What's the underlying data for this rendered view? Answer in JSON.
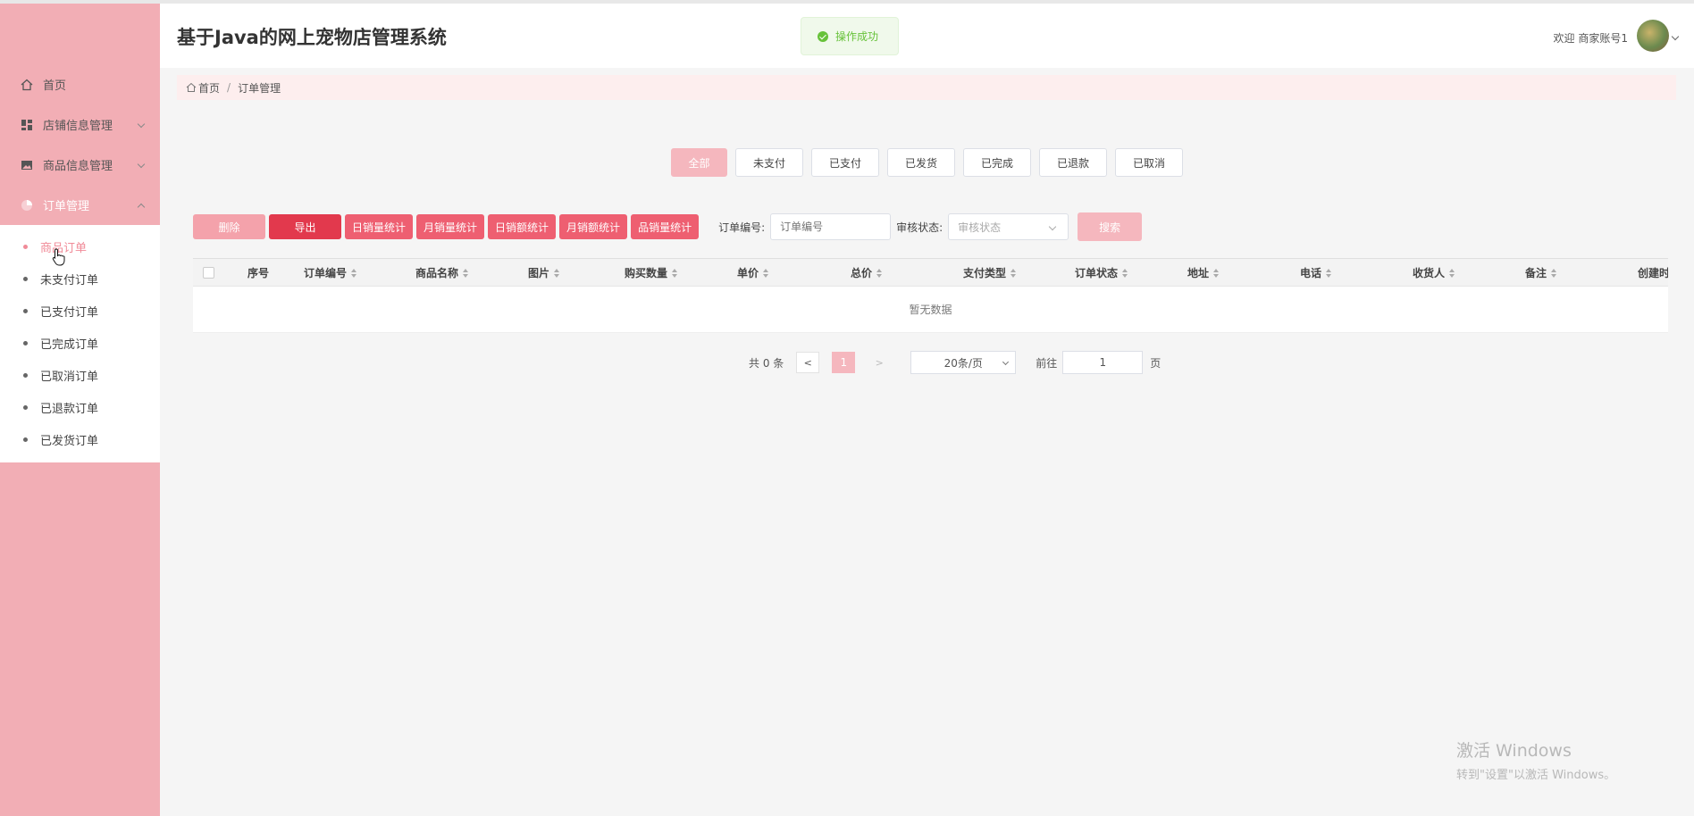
{
  "app": {
    "title": "基于Java的网上宠物店管理系统"
  },
  "toast": {
    "message": "操作成功"
  },
  "user": {
    "welcome": "欢迎 商家账号1"
  },
  "sidebar": {
    "items": [
      {
        "label": "首页"
      },
      {
        "label": "店铺信息管理"
      },
      {
        "label": "商品信息管理"
      },
      {
        "label": "订单管理"
      }
    ],
    "submenu": [
      {
        "label": "商品订单"
      },
      {
        "label": "未支付订单"
      },
      {
        "label": "已支付订单"
      },
      {
        "label": "已完成订单"
      },
      {
        "label": "已取消订单"
      },
      {
        "label": "已退款订单"
      },
      {
        "label": "已发货订单"
      }
    ]
  },
  "breadcrumb": {
    "home": "首页",
    "current": "订单管理"
  },
  "status_filters": [
    "全部",
    "未支付",
    "已支付",
    "已发货",
    "已完成",
    "已退款",
    "已取消"
  ],
  "toolbar": {
    "delete": "删除",
    "export": "导出",
    "daily_qty": "日销量统计",
    "monthly_qty": "月销量统计",
    "daily_amount": "日销额统计",
    "monthly_amount": "月销额统计",
    "product_qty": "品销量统计",
    "order_no_label": "订单编号:",
    "order_no_placeholder": "订单编号",
    "audit_label": "审核状态:",
    "audit_placeholder": "审核状态",
    "search": "搜索"
  },
  "table": {
    "columns": [
      "序号",
      "订单编号",
      "商品名称",
      "图片",
      "购买数量",
      "单价",
      "总价",
      "支付类型",
      "订单状态",
      "地址",
      "电话",
      "收货人",
      "备注",
      "创建时"
    ],
    "empty_text": "暂无数据"
  },
  "pagination": {
    "total": "共 0 条",
    "prev": "<",
    "current_page": "1",
    "next": ">",
    "page_size": "20条/页",
    "goto_label": "前往",
    "goto_value": "1",
    "page_suffix": "页"
  },
  "watermark": {
    "title": "激活 Windows",
    "subtitle": "转到\"设置\"以激活 Windows。"
  }
}
